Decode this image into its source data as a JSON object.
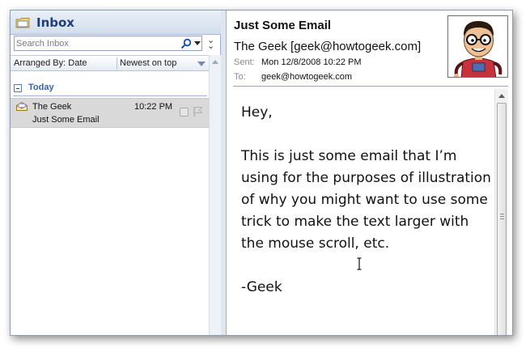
{
  "inbox": {
    "title": "Inbox",
    "search_placeholder": "Search Inbox",
    "arranged_by": "Arranged By: Date",
    "sort_order": "Newest on top",
    "group_label": "Today",
    "messages": [
      {
        "from": "The Geek",
        "time": "10:22 PM",
        "subject": "Just Some Email"
      }
    ]
  },
  "reading_pane": {
    "subject": "Just Some Email",
    "sender": "The Geek [geek@howtogeek.com]",
    "sent_label": "Sent:",
    "sent_value": "Mon 12/8/2008 10:22 PM",
    "to_label": "To:",
    "to_value": "geek@howtogeek.com",
    "body": {
      "greeting": "Hey,",
      "paragraph": "This is just some email that I’m using for the purposes of illustration of why you might want to use some trick to make the text larger with the mouse scroll, etc.",
      "signature": "-Geek"
    }
  },
  "colors": {
    "accent": "#1e3f7a",
    "group_header": "#3a63a8",
    "selection": "#d9d9d9",
    "reading_border": "#e1a84b"
  },
  "icons": [
    "inbox-folder-icon",
    "search-icon",
    "dropdown-arrow-icon",
    "expand-chevrons-icon",
    "collapse-icon",
    "envelope-open-icon",
    "flag-icon",
    "avatar-geek-icon",
    "text-cursor-icon"
  ]
}
